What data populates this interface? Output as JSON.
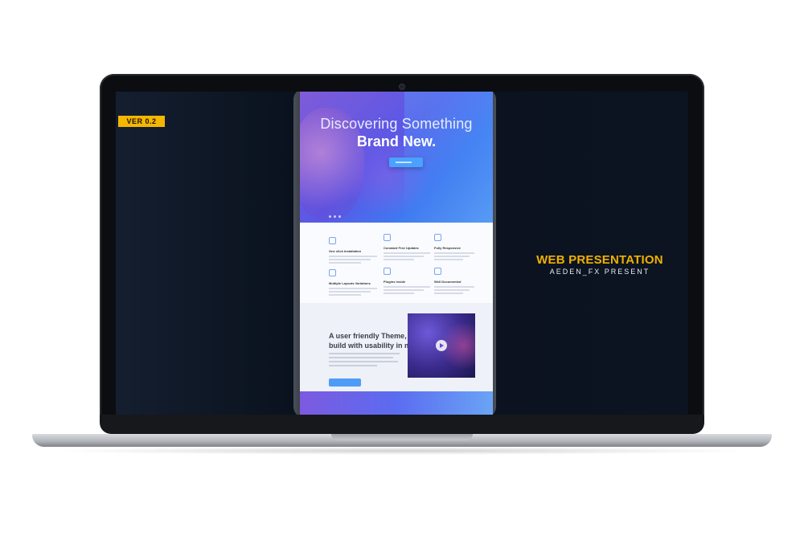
{
  "badge": {
    "label": "VER 0.2"
  },
  "hero": {
    "title": "Discovering Something",
    "subtitle": "Brand New."
  },
  "features": [
    {
      "title": "One click Installation"
    },
    {
      "title": "Constant Free Updates"
    },
    {
      "title": "Fully Responsive"
    },
    {
      "title": "Multiple Layouts Variations"
    },
    {
      "title": "Plugins inside"
    },
    {
      "title": "Well Documented"
    }
  ],
  "section": {
    "title_line1": "A user friendly Theme,",
    "title_line2": "build with usability in mind"
  },
  "presentation": {
    "title": "WEB PRESENTATION",
    "subtitle": "AEDEN_FX PRESENT"
  },
  "colors": {
    "accent": "#f5b600",
    "screen_bg": "#0c1626"
  }
}
